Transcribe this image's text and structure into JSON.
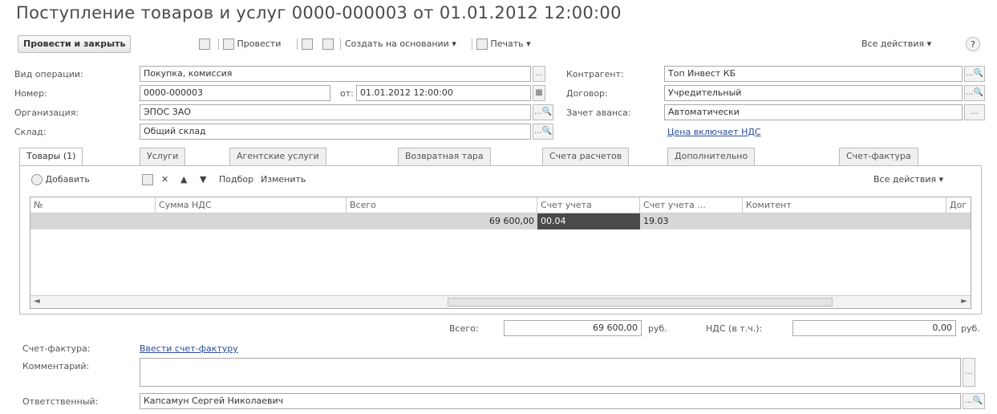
{
  "title": "Поступление товаров и услуг 0000-000003 от 01.01.2012 12:00:00",
  "toolbar": {
    "post_close": "Провести и закрыть",
    "post": "Провести",
    "create_based": "Создать на основании",
    "print": "Печать",
    "all_actions": "Все действия",
    "help": "?"
  },
  "header": {
    "operation_label": "Вид операции:",
    "operation_value": "Покупка, комиссия",
    "number_label": "Номер:",
    "number_value": "0000-000003",
    "date_label": "от:",
    "date_value": "01.01.2012 12:00:00",
    "org_label": "Организация:",
    "org_value": "ЭПОС ЗАО",
    "warehouse_label": "Склад:",
    "warehouse_value": "Общий склад",
    "counterparty_label": "Контрагент:",
    "counterparty_value": "Топ Инвест КБ",
    "contract_label": "Договор:",
    "contract_value": "Учредительный",
    "advance_label": "Зачет аванса:",
    "advance_value": "Автоматически",
    "vat_link": "Цена включает НДС"
  },
  "tabs": [
    "Товары (1)",
    "Услуги",
    "Агентские услуги",
    "Возвратная тара",
    "Счета расчетов",
    "Дополнительно",
    "Счет-фактура"
  ],
  "table_toolbar": {
    "add": "Добавить",
    "selection": "Подбор",
    "change": "Изменить",
    "all_actions": "Все действия"
  },
  "table": {
    "columns": [
      "№",
      "Сумма НДС",
      "Всего",
      "Счет учета",
      "Счет учета ...",
      "Комитент",
      "Дог"
    ],
    "rows": [
      [
        "",
        "",
        "69 600,00",
        "00.04",
        "19.03",
        "",
        ""
      ]
    ]
  },
  "totals": {
    "total_label": "Всего:",
    "total_value": "69 600,00",
    "currency1": "руб.",
    "vat_label": "НДС (в т.ч.):",
    "vat_value": "0,00",
    "currency2": "руб."
  },
  "footer": {
    "invoice_label": "Счет-фактура:",
    "invoice_link": "Ввести счет-фактуру",
    "comment_label": "Комментарий:",
    "comment_value": "",
    "responsible_label": "Ответственный:",
    "responsible_value": "Капсамун Сергей Николаевич"
  }
}
